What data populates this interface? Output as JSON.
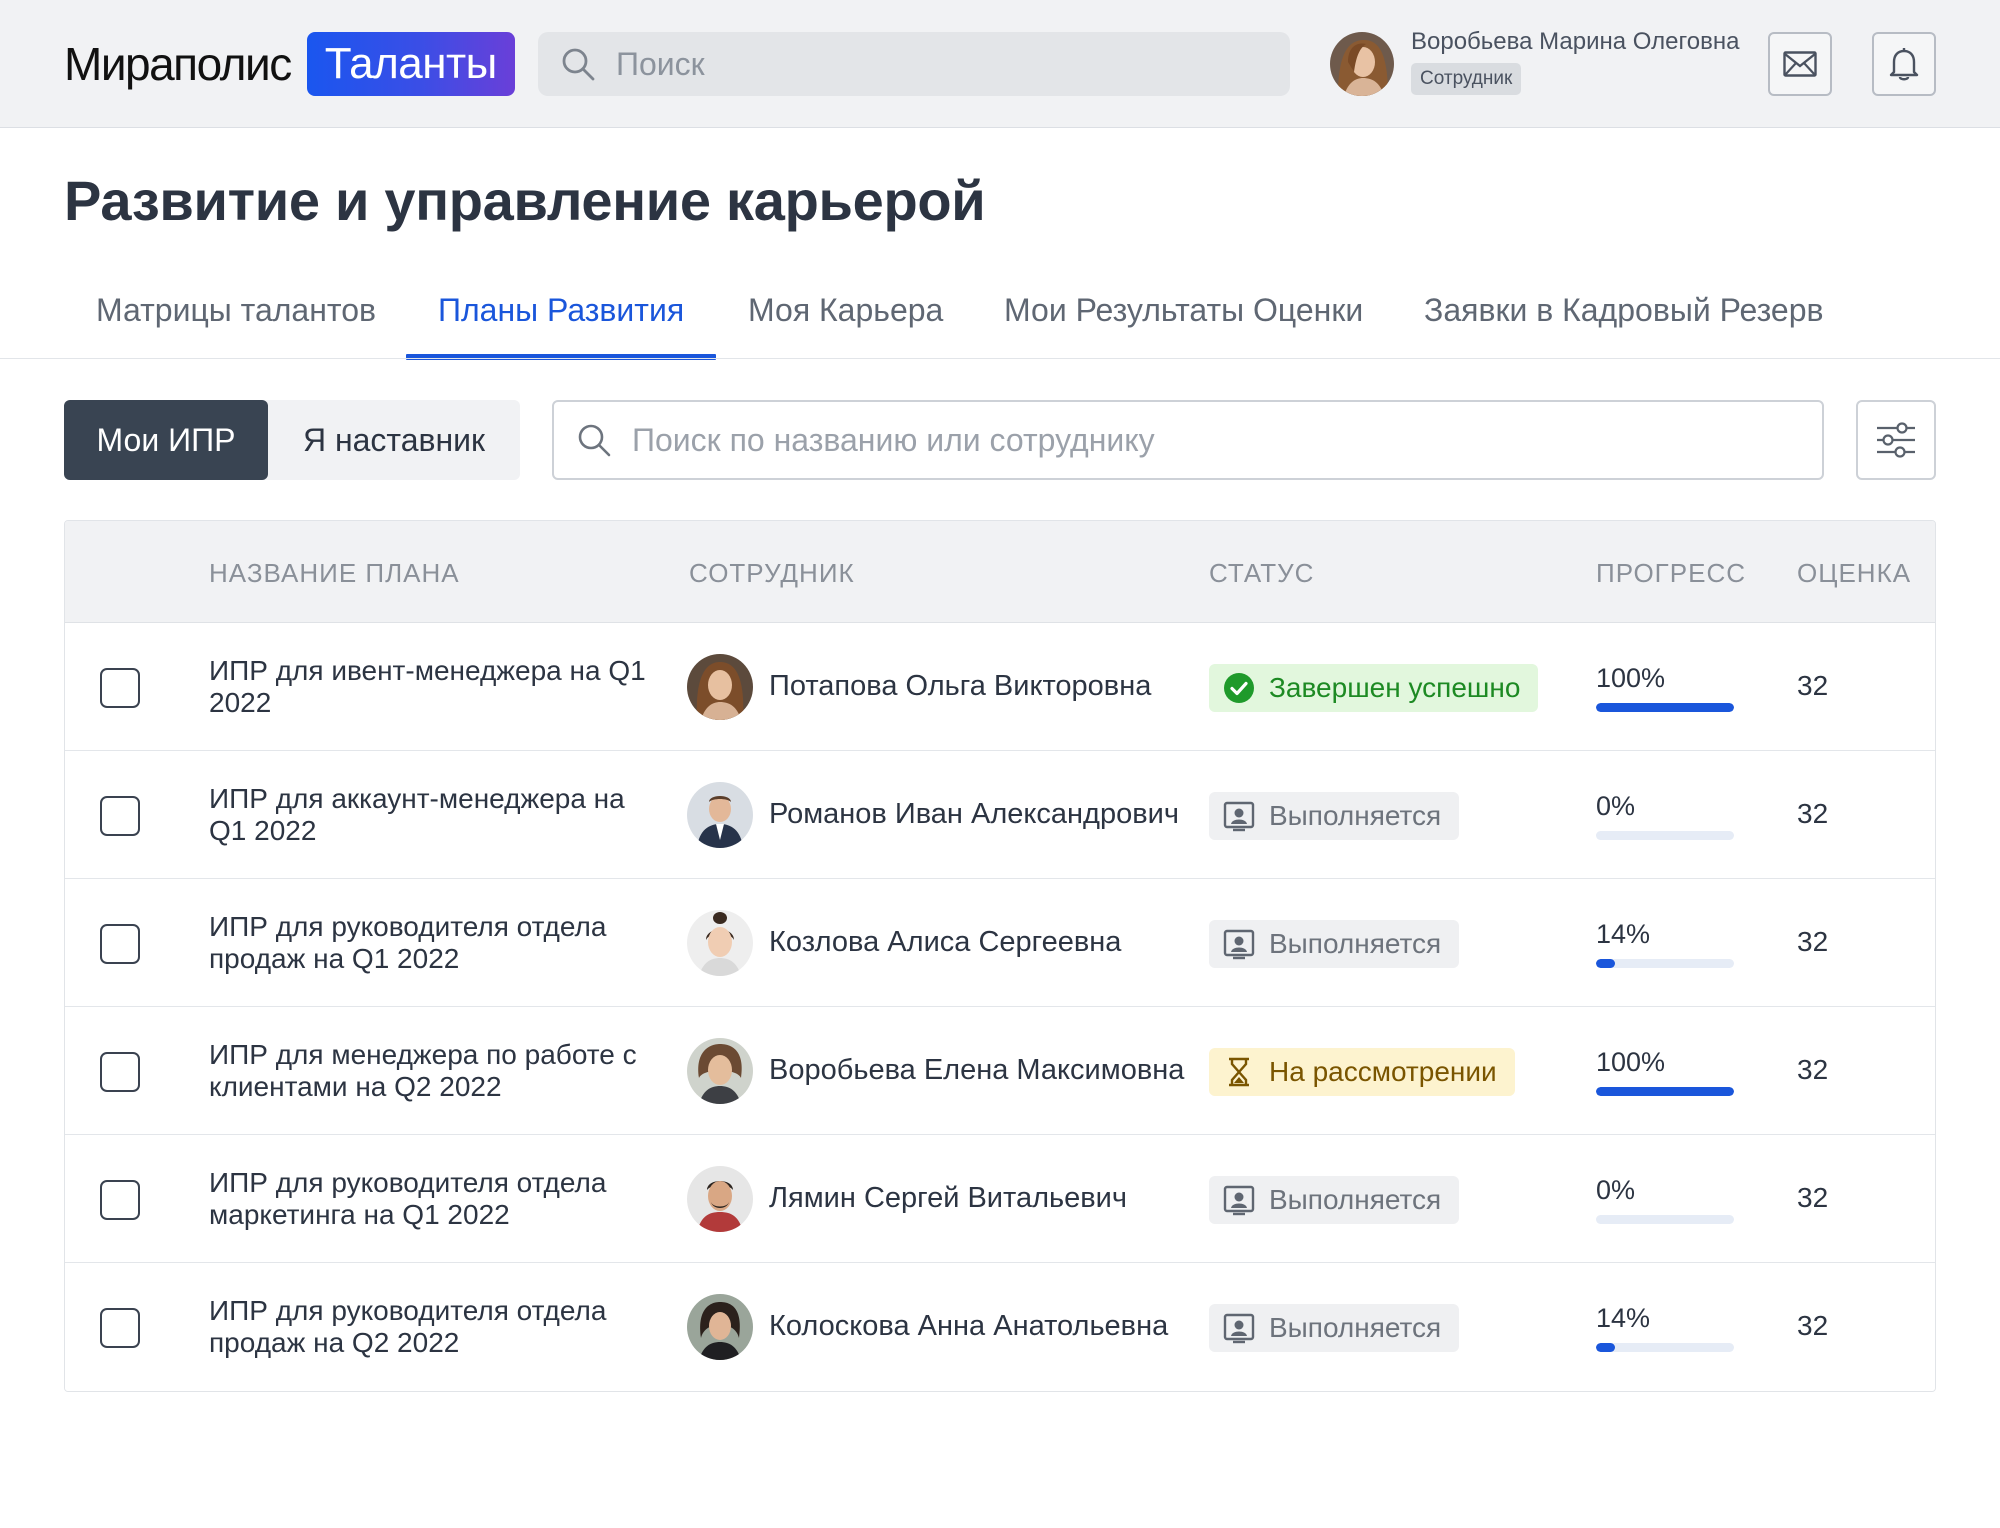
{
  "header": {
    "logo_main": "Мираполис",
    "logo_badge": "Таланты",
    "search_placeholder": "Поиск",
    "user_name": "Воробьева Марина Олеговна",
    "user_role": "Сотрудник",
    "mail_icon": "mail-icon",
    "bell_icon": "bell-icon"
  },
  "page": {
    "title": "Развитие и управление карьерой"
  },
  "tabs": [
    {
      "label": "Матрицы талантов",
      "active": false
    },
    {
      "label": "Планы Развития",
      "active": true
    },
    {
      "label": "Моя Карьера",
      "active": false
    },
    {
      "label": "Мои Результаты Оценки",
      "active": false
    },
    {
      "label": "Заявки в Кадровый Резерв",
      "active": false
    }
  ],
  "toolbar": {
    "segments": [
      "Мои ИПР",
      "Я наставник"
    ],
    "active_segment": "Мои ИПР",
    "search_placeholder": "Поиск по названию или сотруднику",
    "filter_icon": "filter-sliders-icon"
  },
  "table": {
    "columns": [
      "НАЗВАНИЕ ПЛАНА",
      "СОТРУДНИК",
      "СТАТУС",
      "ПРОГРЕСС",
      "ОЦЕНКА"
    ],
    "rows": [
      {
        "plan": "ИПР для ивент-менеджера на Q1 2022",
        "employee": "Потапова Ольга Викторовна",
        "status": "Завершен успешно",
        "status_type": "done",
        "progress_text": "100%",
        "progress": 1.0,
        "score": "32"
      },
      {
        "plan": "ИПР для аккаунт-менеджера на Q1 2022",
        "employee": "Романов Иван Александрович",
        "status": "Выполняется",
        "status_type": "progress",
        "progress_text": "0%",
        "progress": 0.0,
        "score": "32"
      },
      {
        "plan": "ИПР для руководителя отдела продаж на Q1 2022",
        "employee": "Козлова Алиса Сергеевна",
        "status": "Выполняется",
        "status_type": "progress",
        "progress_text": "14%",
        "progress": 0.14,
        "score": "32"
      },
      {
        "plan": "ИПР для менеджера по работе с клиентами на Q2 2022",
        "employee": "Воробьева Елена Максимовна",
        "status": "На рассмотрении",
        "status_type": "review",
        "progress_text": "100%",
        "progress": 1.0,
        "score": "32"
      },
      {
        "plan": "ИПР для руководителя отдела маркетинга на Q1 2022",
        "employee": "Лямин Сергей Витальевич",
        "status": "Выполняется",
        "status_type": "progress",
        "progress_text": "0%",
        "progress": 0.0,
        "score": "32"
      },
      {
        "plan": "ИПР для руководителя отдела продаж на Q2 2022",
        "employee": "Колоскова Анна Анатольевна",
        "status": "Выполняется",
        "status_type": "progress",
        "progress_text": "14%",
        "progress": 0.14,
        "score": "32"
      }
    ]
  },
  "colors": {
    "accent": "#1a56db",
    "done_bg": "#e2f7dd",
    "done_fg": "#1d8a23",
    "progress_bg": "#eff0f2",
    "review_bg": "#fdf3cf"
  }
}
